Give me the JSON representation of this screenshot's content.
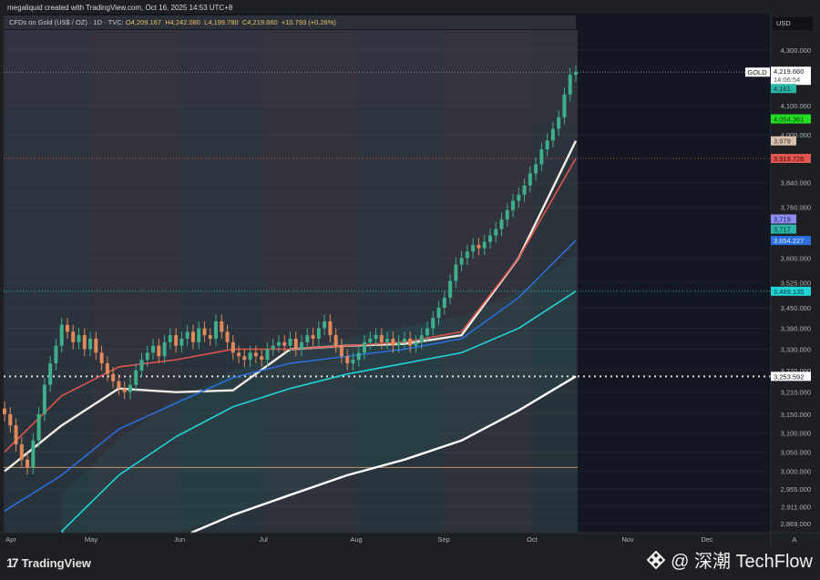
{
  "header": {
    "attribution": "megaliquid created with TradingView.com, Oct 16, 2025 14:53 UTC+8",
    "symbol_desc": "CFDs on Gold (US$ / OZ) · 1D · TVC",
    "open": "O4,209.167",
    "high": "H4,242.080",
    "low": "L4,199.780",
    "close": "C4,219.660",
    "change": "+10.793 (+0.26%)"
  },
  "currency": "USD",
  "axis_mode": "A",
  "footer": {
    "brand": "TradingView",
    "watermark": "@ 深潮 TechFlow"
  },
  "colors": {
    "bull": "#3fae8a",
    "bear": "#e08a5c",
    "bg": "#131722",
    "plot": "#2a2e36"
  },
  "chart_data": {
    "type": "candlestick",
    "title": "CFDs on Gold (US$ / OZ) 1D",
    "scale": "log",
    "ylim": [
      2845,
      4360
    ],
    "y_ticks": [
      4300,
      4100,
      4000,
      3840,
      3760,
      3600,
      3525,
      3450,
      3390,
      3330,
      3270,
      3210,
      3150,
      3100,
      3050,
      3000,
      2955,
      2911,
      2869
    ],
    "y_tick_labels": [
      "4,300.000",
      "4,100.000",
      "4,000.000",
      "3,840.000",
      "3,760.000",
      "3,600.000",
      "3,525.000",
      "3,450.000",
      "3,390.000",
      "3,330.000",
      "3,270.000",
      "3,210.000",
      "3,150.000",
      "3,100.000",
      "3,050.000",
      "3,000.000",
      "2,955.000",
      "2,911.000",
      "2,869.000"
    ],
    "x_months": [
      "Apr",
      "May",
      "Jun",
      "Jul",
      "Aug",
      "Sep",
      "Oct",
      "Nov",
      "Dec"
    ],
    "closes": [
      3150,
      3120,
      3070,
      3030,
      3010,
      3080,
      3150,
      3230,
      3290,
      3340,
      3400,
      3380,
      3350,
      3370,
      3330,
      3360,
      3320,
      3290,
      3260,
      3240,
      3220,
      3210,
      3230,
      3270,
      3300,
      3320,
      3340,
      3310,
      3350,
      3370,
      3340,
      3360,
      3380,
      3350,
      3390,
      3370,
      3360,
      3410,
      3380,
      3350,
      3320,
      3310,
      3300,
      3320,
      3310,
      3300,
      3330,
      3340,
      3350,
      3340,
      3360,
      3330,
      3350,
      3370,
      3360,
      3390,
      3410,
      3370,
      3340,
      3310,
      3290,
      3300,
      3320,
      3350,
      3360,
      3370,
      3350,
      3360,
      3340,
      3350,
      3360,
      3340,
      3350,
      3370,
      3390,
      3420,
      3450,
      3480,
      3530,
      3580,
      3600,
      3620,
      3640,
      3630,
      3650,
      3670,
      3690,
      3720,
      3750,
      3780,
      3800,
      3830,
      3870,
      3900,
      3950,
      3980,
      4020,
      4060,
      4140,
      4210,
      4219.66
    ],
    "ma_step": 10,
    "series": [
      {
        "name": "MA short",
        "color": "#f1ece4",
        "values": [
          3000,
          3120,
          3220,
          3210,
          3215,
          3330,
          3340,
          3345,
          3370,
          3600,
          3979
        ]
      },
      {
        "name": "MA red",
        "color": "#e0554d",
        "values": [
          3050,
          3200,
          3280,
          3300,
          3330,
          3330,
          3340,
          3350,
          3380,
          3600,
          3919.726
        ]
      },
      {
        "name": "MA blue",
        "color": "#2a6fdb",
        "values": [
          2900,
          2990,
          3110,
          3180,
          3250,
          3290,
          3310,
          3330,
          3360,
          3480,
          3654.227
        ]
      },
      {
        "name": "MA cyan",
        "color": "#22d3d6",
        "values": [
          null,
          2850,
          2990,
          3090,
          3170,
          3220,
          3260,
          3290,
          3320,
          3390,
          3499.135
        ]
      },
      {
        "name": "MA long",
        "color": "#ffffff",
        "values": [
          null,
          null,
          null,
          null,
          2890,
          2940,
          2990,
          3030,
          3080,
          3160,
          3253.592
        ]
      }
    ],
    "hlines": [
      {
        "value": 4219.66,
        "color": "#9aa0a8",
        "style": "dotted"
      },
      {
        "value": 3919.726,
        "color": "#e0554d",
        "style": "dotted"
      },
      {
        "value": 3499.135,
        "color": "#22d3d6",
        "style": "dotted"
      },
      {
        "value": 3253.592,
        "color": "#ffffff",
        "style": "dotted"
      },
      {
        "value": 3010,
        "color": "#e0a070",
        "style": "solid"
      }
    ],
    "price_badges": [
      {
        "label": "GOLD",
        "text": "4,219.660",
        "sub": "14:06:54",
        "value": 4219.66,
        "bg": "#ffffff",
        "fg": "#131722"
      },
      {
        "text": "4,161",
        "value": 4161,
        "bg": "#2bb5a8",
        "fg": "#0d3b36"
      },
      {
        "text": "4,054.361",
        "value": 4054.361,
        "bg": "#22dd22",
        "fg": "#0b3a0b"
      },
      {
        "text": "3,979",
        "value": 3979,
        "bg": "#d9c3b0",
        "fg": "#3a2a1c"
      },
      {
        "text": "3,919.726",
        "value": 3919.726,
        "bg": "#e0554d",
        "fg": "#3a0d0a"
      },
      {
        "text": "3,719",
        "value": 3722,
        "bg": "#8f8cf0",
        "fg": "#23205a"
      },
      {
        "text": "3,717",
        "value": 3690,
        "bg": "#2bb5a8",
        "fg": "#0d3b36"
      },
      {
        "text": "3,654.227",
        "value": 3654.227,
        "bg": "#2a6fdb",
        "fg": "#dde8ff"
      },
      {
        "text": "3,499.135",
        "value": 3499.135,
        "bg": "#22d3d6",
        "fg": "#0a3a3b"
      },
      {
        "text": "3,253.592",
        "value": 3253.592,
        "bg": "#ffffff",
        "fg": "#131722"
      }
    ]
  }
}
